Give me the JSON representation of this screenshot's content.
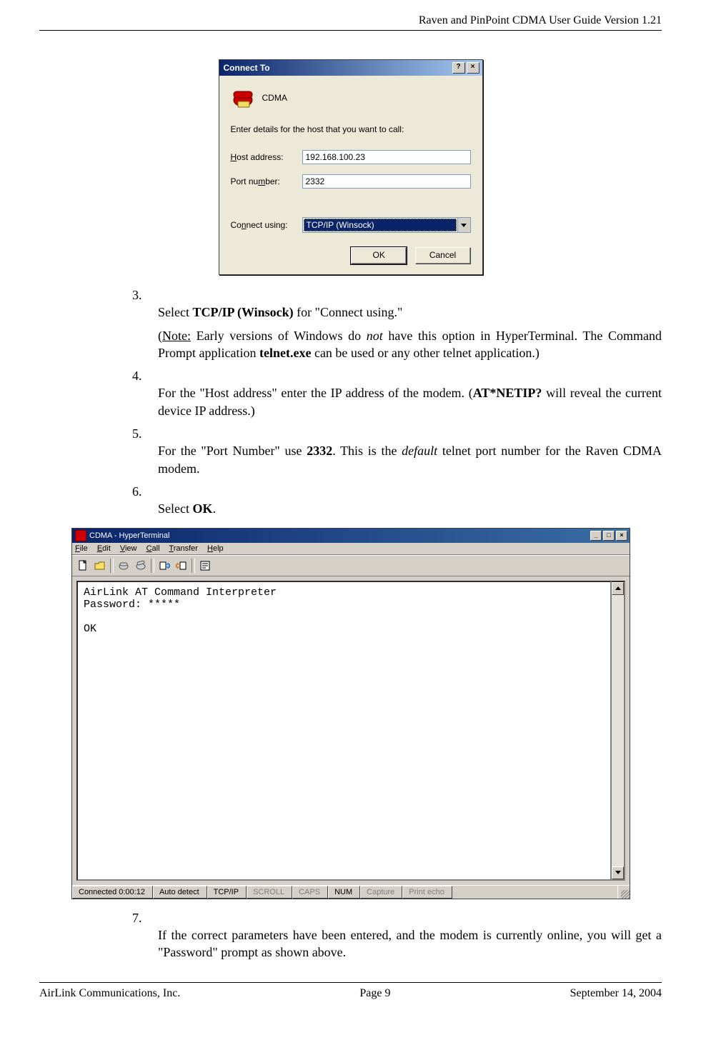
{
  "header": {
    "title": "Raven and PinPoint CDMA User Guide Version 1.21"
  },
  "footer": {
    "left": "AirLink Communications, Inc.",
    "center": "Page 9",
    "right": "September 14, 2004"
  },
  "dialog": {
    "title": "Connect To",
    "help_btn": "?",
    "close_btn": "×",
    "connection_name": "CDMA",
    "instruction": "Enter details for the host that you want to call:",
    "host_label_pre": "H",
    "host_label_post": "ost address:",
    "host_value": "192.168.100.23",
    "port_label_pre": "Port nu",
    "port_label_u": "m",
    "port_label_post": "ber:",
    "port_value": "2332",
    "connect_label_pre": "Co",
    "connect_label_u": "n",
    "connect_label_post": "nect using:",
    "connect_using": "TCP/IP (Winsock)",
    "ok_btn": "OK",
    "cancel_btn": "Cancel"
  },
  "steps": {
    "s3_pre": "3.",
    "s3_a": "Select ",
    "s3_bold": "TCP/IP (Winsock)",
    "s3_b": " for \"Connect using.\"",
    "s3_note_lead": "(",
    "s3_note_u": "Note:",
    "s3_note_a": " Early versions of Windows do ",
    "s3_note_i": "not",
    "s3_note_b": " have this option in HyperTerminal. The Command Prompt application ",
    "s3_note_bold": "telnet.exe",
    "s3_note_c": " can be used or any other telnet application.)",
    "s4_pre": "4.",
    "s4_a": "For the \"Host address\" enter the IP address of the modem. (",
    "s4_bold": "AT*NETIP?",
    "s4_b": " will reveal the current device IP address.)",
    "s5_pre": "5.",
    "s5_a": "For the \"Port Number\" use ",
    "s5_bold": "2332",
    "s5_b": ". This is the ",
    "s5_i": "default",
    "s5_c": " telnet port number for the Raven CDMA modem.",
    "s6_pre": "6.",
    "s6_a": "Select ",
    "s6_bold": "OK",
    "s6_b": ".",
    "s7_pre": "7.",
    "s7_a": "If the correct parameters have been entered, and the modem is currently online, you will get a \"Password\" prompt as shown above."
  },
  "hyper": {
    "title": "CDMA - HyperTerminal",
    "min": "_",
    "max": "□",
    "close": "×",
    "menu": {
      "file": "File",
      "edit": "Edit",
      "view": "View",
      "call": "Call",
      "transfer": "Transfer",
      "help": "Help"
    },
    "terminal_line1": "AirLink AT Command Interpreter",
    "terminal_line2": "Password: *****",
    "terminal_line3": "",
    "terminal_line4": "OK",
    "status": {
      "connected": "Connected 0:00:12",
      "auto": "Auto detect",
      "proto": "TCP/IP",
      "scroll": "SCROLL",
      "caps": "CAPS",
      "num": "NUM",
      "capture": "Capture",
      "echo": "Print echo"
    }
  }
}
